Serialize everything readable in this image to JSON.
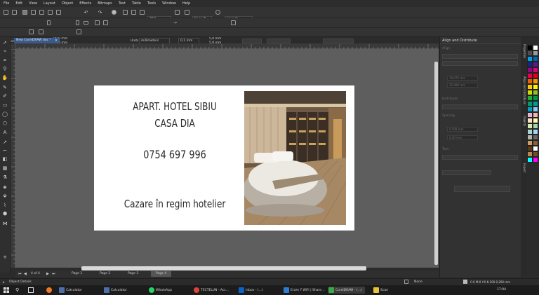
{
  "menu": [
    "File",
    "Edit",
    "View",
    "Layout",
    "Object",
    "Effects",
    "Bitmaps",
    "Text",
    "Table",
    "Tools",
    "Window",
    "Help"
  ],
  "toolbar": {
    "zoom": "75%",
    "snap_to": "Snap To",
    "launch": "Launch"
  },
  "property_bar": {
    "page_preset": "Custom",
    "width": "88,9 mm",
    "height": "50,8 mm",
    "units_label": "Units:",
    "units": "millimeters",
    "nudge": "0,1 mm",
    "dup_x": "5,0 mm",
    "dup_y": "5,0 mm"
  },
  "document": {
    "tab_title": "New CorelDRAW doc *",
    "close_glyph": "×"
  },
  "card": {
    "line1": "APART. HOTEL SIBIU",
    "line2": "CASA DIA",
    "phone": "0754 697 996",
    "tagline": "Cazare în regim hotelier"
  },
  "pages": {
    "counter": "4 of 4",
    "tabs": [
      "Page 1",
      "Page 2",
      "Page 3",
      "Page 4"
    ],
    "active_index": 3
  },
  "align_panel": {
    "title": "Align and Distribute",
    "sections": [
      "Align",
      "Distribute",
      "Spacing",
      "Text"
    ],
    "field_1": "39,075 mm",
    "field_2": "25,000 mm",
    "field_3": "0,508 mm",
    "field_4": "0,00 mm"
  },
  "side_tabs": [
    "Properties",
    "Align and Distribute",
    "Objects",
    "Export"
  ],
  "palette_colors": [
    "#000000",
    "#ffffff",
    "#4d4d4d",
    "#999999",
    "#00a0e9",
    "#0068b7",
    "#1d2088",
    "#601986",
    "#920783",
    "#e4007f",
    "#e5004f",
    "#e60012",
    "#eb6100",
    "#f39800",
    "#fcc800",
    "#fff100",
    "#cfdb00",
    "#8fc31f",
    "#22ac38",
    "#009944",
    "#009b6b",
    "#009e96",
    "#00a0c1",
    "#7ecef4",
    "#e8b0d0",
    "#f5b2b2",
    "#fce2c4",
    "#fff9b1",
    "#d7e7af",
    "#a5d4ad",
    "#a3d6cc",
    "#a0d8ef",
    "#b3b3b3",
    "#666666",
    "#c9a063",
    "#8c6239",
    "#603813",
    "#ffffff",
    "#b28850",
    "#754c24",
    "#00ffff",
    "#ff00ff"
  ],
  "status": {
    "object_details": "Object Details",
    "fill": "None",
    "outline": "C:0 M:0 Y:0 K:100  0,200 mm"
  },
  "taskbar": {
    "items": [
      "Calculator",
      "Calculator",
      "WhatsApp",
      "TECTELUN - Acc...",
      "Inbox - (...)",
      "Eram 7 WiFi | Share...",
      "CorelDRAW - (...)",
      "Scan"
    ],
    "time": "17:04"
  },
  "colors": {
    "accent": "#3a5a8a",
    "canvas": "#5e5e5e",
    "card": "#ffffff",
    "card_text": "#2a2a2a"
  }
}
